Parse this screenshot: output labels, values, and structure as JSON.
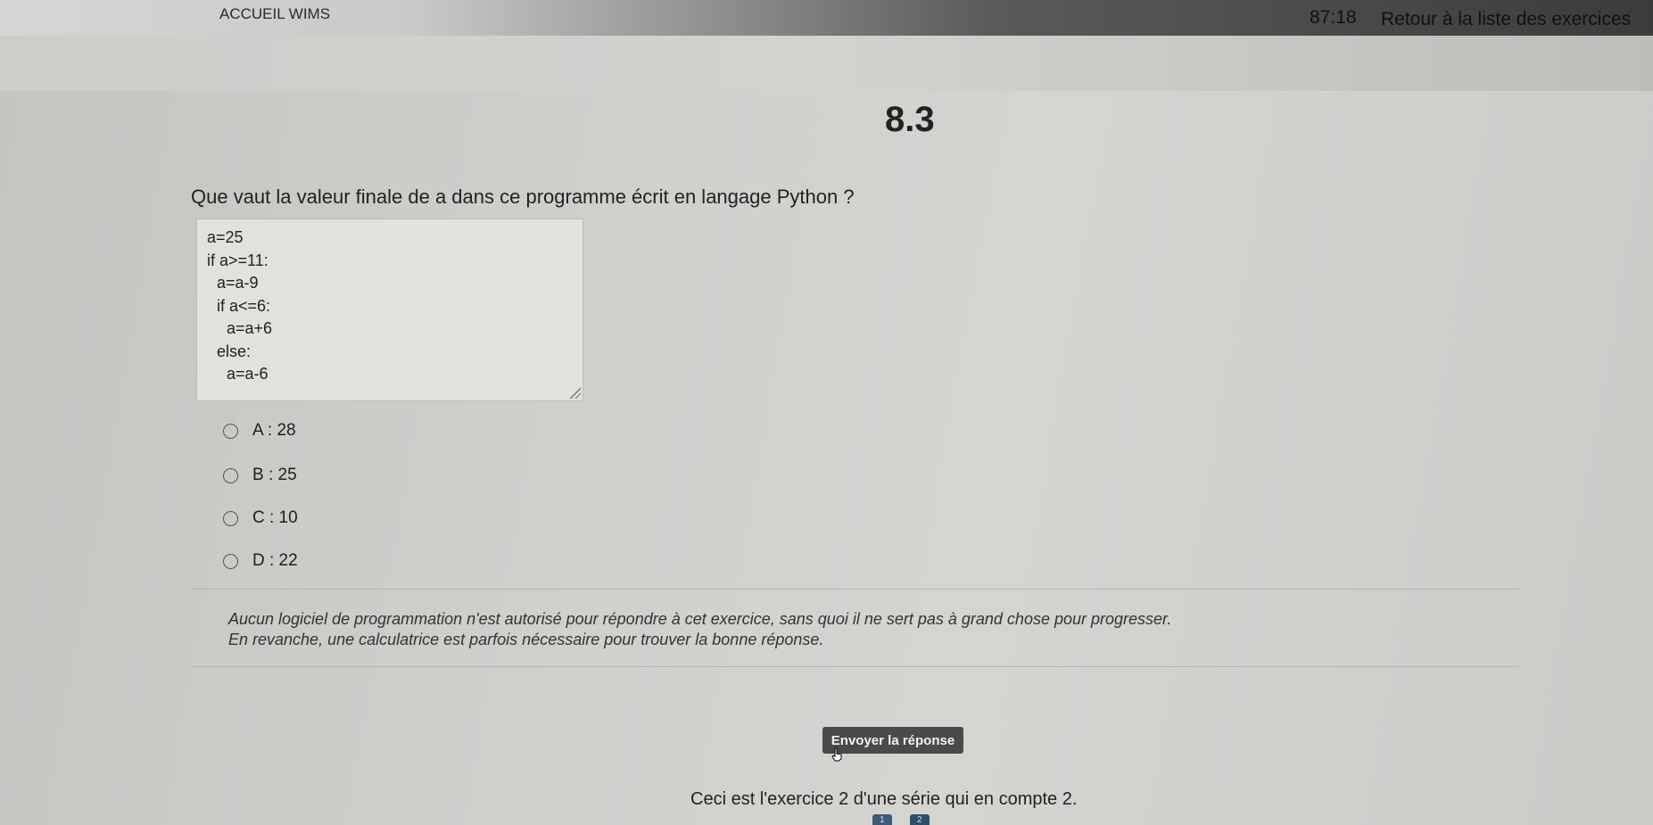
{
  "topbar": {
    "home_label": "ACCUEIL WIMS",
    "timer": "87:18",
    "back_label": "Retour à la liste des exercices"
  },
  "exercise": {
    "title": "8.3",
    "question": "Que vaut la valeur finale de a dans ce programme écrit en langage Python ?",
    "code_lines": [
      {
        "indent": 0,
        "text": "a=25"
      },
      {
        "indent": 0,
        "text": "if a>=11:"
      },
      {
        "indent": 1,
        "text": "a=a-9"
      },
      {
        "indent": 1,
        "text": "if a<=6:"
      },
      {
        "indent": 2,
        "text": "a=a+6"
      },
      {
        "indent": 1,
        "text": "else:"
      },
      {
        "indent": 2,
        "text": "a=a-6"
      }
    ],
    "choices": [
      {
        "label": "A : 28"
      },
      {
        "label": "B : 25"
      },
      {
        "label": "C : 10"
      },
      {
        "label": "D : 22"
      }
    ]
  },
  "note": {
    "line1": "Aucun logiciel de programmation n'est autorisé pour répondre à cet exercice, sans quoi il ne sert pas à grand chose pour progresser.",
    "line2": "En revanche, une calculatrice est parfois nécessaire pour trouver la bonne réponse."
  },
  "submit_label": "Envoyer la réponse",
  "footer_text": "Ceci est l'exercice 2 d'une série qui en compte 2.",
  "pager": [
    "1",
    "2"
  ]
}
